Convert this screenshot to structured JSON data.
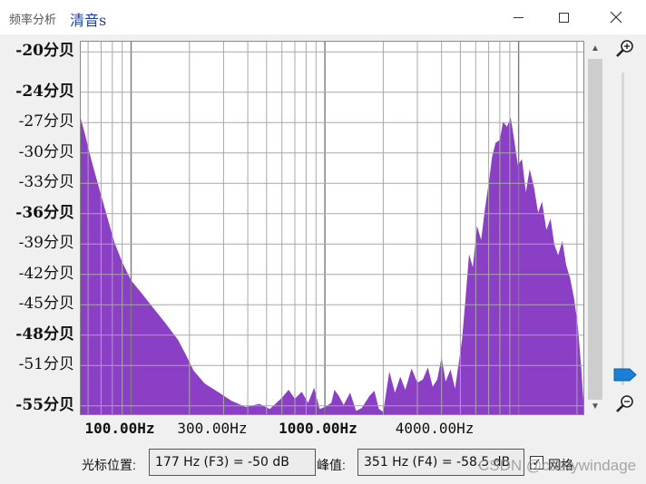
{
  "window": {
    "title_prefix": "频率分析",
    "title_name": "清音s",
    "minimize_glyph": "—",
    "maximize_glyph": "☐",
    "close_glyph": "✕"
  },
  "chart_data": {
    "type": "area",
    "scale_x": "log",
    "xlim_hz": [
      55,
      22050
    ],
    "ylim_db": [
      -56,
      -19
    ],
    "y_ticks": [
      {
        "value": -20,
        "label": "-20分贝",
        "bold": true
      },
      {
        "value": -24,
        "label": "-24分贝",
        "bold": true
      },
      {
        "value": -27,
        "label": "-27分贝",
        "bold": false
      },
      {
        "value": -30,
        "label": "-30分贝",
        "bold": false
      },
      {
        "value": -33,
        "label": "-33分贝",
        "bold": false
      },
      {
        "value": -36,
        "label": "-36分贝",
        "bold": true
      },
      {
        "value": -39,
        "label": "-39分贝",
        "bold": false
      },
      {
        "value": -42,
        "label": "-42分贝",
        "bold": false
      },
      {
        "value": -45,
        "label": "-45分贝",
        "bold": false
      },
      {
        "value": -48,
        "label": "-48分贝",
        "bold": true
      },
      {
        "value": -51,
        "label": "-51分贝",
        "bold": false
      },
      {
        "value": -55,
        "label": "-55分贝",
        "bold": true
      }
    ],
    "x_ticks": [
      {
        "value": 100,
        "label": "100.00Hz",
        "bold": true
      },
      {
        "value": 300,
        "label": "300.00Hz",
        "bold": false
      },
      {
        "value": 1000,
        "label": "1000.00Hz",
        "bold": true
      },
      {
        "value": 4000,
        "label": "4000.00Hz",
        "bold": false
      }
    ],
    "major_grid_hz": [
      100,
      1000,
      10000
    ],
    "minor_grid_hz": [
      60,
      70,
      80,
      90,
      200,
      300,
      400,
      500,
      600,
      700,
      800,
      900,
      2000,
      3000,
      4000,
      5000,
      6000,
      7000,
      8000,
      9000,
      20000
    ],
    "grid": true,
    "fill_color": "#8b3fc4",
    "grid_color": "#a8a8a8",
    "major_grid_color": "#7a7a7a",
    "series": [
      {
        "points": [
          [
            55,
            -26.6
          ],
          [
            58,
            -28.2
          ],
          [
            62,
            -30.5
          ],
          [
            68,
            -33.3
          ],
          [
            75,
            -36.2
          ],
          [
            82,
            -38.8
          ],
          [
            90,
            -40.8
          ],
          [
            100,
            -42.6
          ],
          [
            115,
            -44.0
          ],
          [
            130,
            -45.3
          ],
          [
            150,
            -46.8
          ],
          [
            175,
            -48.5
          ],
          [
            190,
            -49.8
          ],
          [
            210,
            -51.5
          ],
          [
            240,
            -52.8
          ],
          [
            280,
            -53.6
          ],
          [
            330,
            -54.5
          ],
          [
            390,
            -55.1
          ],
          [
            460,
            -54.8
          ],
          [
            520,
            -55.3
          ],
          [
            600,
            -54.2
          ],
          [
            650,
            -53.4
          ],
          [
            700,
            -54.3
          ],
          [
            760,
            -53.6
          ],
          [
            820,
            -54.7
          ],
          [
            880,
            -53.2
          ],
          [
            940,
            -55.3
          ],
          [
            1000,
            -55.1
          ],
          [
            1080,
            -54.7
          ],
          [
            1120,
            -53.4
          ],
          [
            1180,
            -54.0
          ],
          [
            1250,
            -54.9
          ],
          [
            1350,
            -53.7
          ],
          [
            1450,
            -55.5
          ],
          [
            1550,
            -55.2
          ],
          [
            1700,
            -54.0
          ],
          [
            1800,
            -53.5
          ],
          [
            1900,
            -55.3
          ],
          [
            2000,
            -55.6
          ],
          [
            2150,
            -51.6
          ],
          [
            2300,
            -53.7
          ],
          [
            2450,
            -52.1
          ],
          [
            2600,
            -53.4
          ],
          [
            2800,
            -51.3
          ],
          [
            3000,
            -52.7
          ],
          [
            3200,
            -52.4
          ],
          [
            3400,
            -51.2
          ],
          [
            3600,
            -53.1
          ],
          [
            3800,
            -52.4
          ],
          [
            4000,
            -50.2
          ],
          [
            4200,
            -52.6
          ],
          [
            4450,
            -51.4
          ],
          [
            4700,
            -53.3
          ],
          [
            4900,
            -50.8
          ],
          [
            5100,
            -48.5
          ],
          [
            5300,
            -44.7
          ],
          [
            5550,
            -40.0
          ],
          [
            5800,
            -41.3
          ],
          [
            6100,
            -37.2
          ],
          [
            6400,
            -38.6
          ],
          [
            6700,
            -35.5
          ],
          [
            7000,
            -33.0
          ],
          [
            7300,
            -30.3
          ],
          [
            7600,
            -29.0
          ],
          [
            8000,
            -28.7
          ],
          [
            8300,
            -26.9
          ],
          [
            8700,
            -27.4
          ],
          [
            9100,
            -26.5
          ],
          [
            9500,
            -28.8
          ],
          [
            9900,
            -31.2
          ],
          [
            10400,
            -30.6
          ],
          [
            10900,
            -33.9
          ],
          [
            11400,
            -31.6
          ],
          [
            12000,
            -33.4
          ],
          [
            12600,
            -35.9
          ],
          [
            13200,
            -34.8
          ],
          [
            13900,
            -37.6
          ],
          [
            14600,
            -36.5
          ],
          [
            15300,
            -39.1
          ],
          [
            16000,
            -40.1
          ],
          [
            16800,
            -38.7
          ],
          [
            17600,
            -41.1
          ],
          [
            18400,
            -42.3
          ],
          [
            19300,
            -44.3
          ],
          [
            20200,
            -47.1
          ],
          [
            21000,
            -51.1
          ],
          [
            21600,
            -54.6
          ],
          [
            22050,
            -55.8
          ]
        ]
      }
    ]
  },
  "bottom": {
    "cursor_label": "光标位置:",
    "cursor_value": "177 Hz (F3) = -50 dB",
    "peak_label": "峰值:",
    "peak_value": "351 Hz (F4) = -58.5 dB",
    "grid_checkbox_label": "网格",
    "grid_checked": true,
    "check_glyph": "✓",
    "watermark": "CSDN @cathywindage"
  },
  "scrollbar": {
    "up_glyph": "▲",
    "down_glyph": "▼"
  }
}
